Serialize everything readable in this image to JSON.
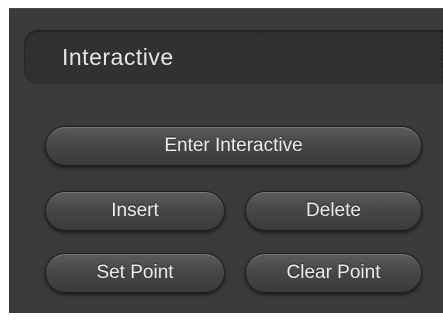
{
  "panel": {
    "title": "Interactive"
  },
  "buttons": {
    "enter_interactive": "Enter Interactive",
    "insert": "Insert",
    "delete": "Delete",
    "set_point": "Set Point",
    "clear_point": "Clear Point"
  },
  "colors": {
    "panel_background": "#3a3a3a",
    "header_background": "#303030",
    "button_text": "#ececec"
  }
}
